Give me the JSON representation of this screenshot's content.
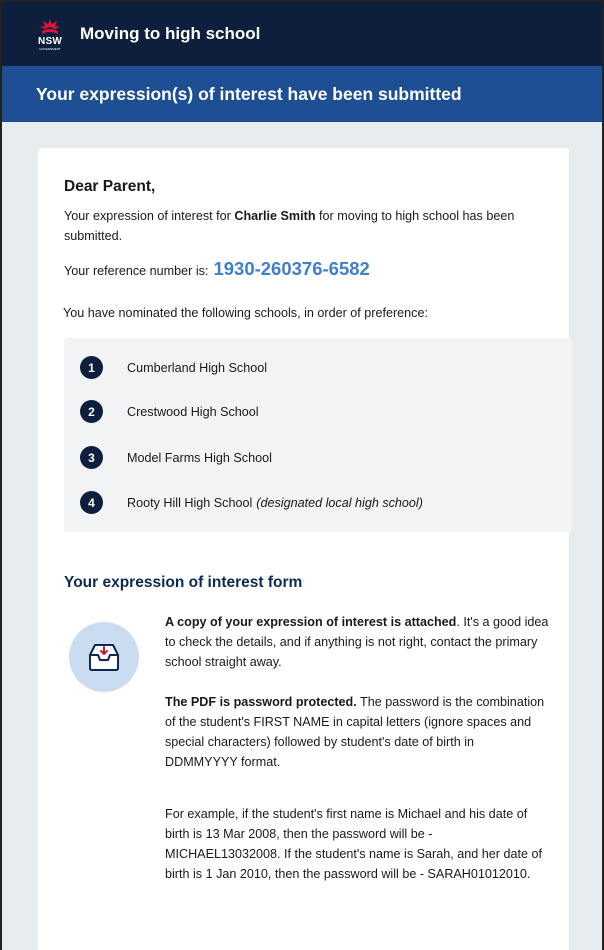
{
  "header": {
    "logo_text": "NSW",
    "logo_subtext": "GOVERNMENT",
    "app_title": "Moving to high school"
  },
  "banner": {
    "title": "Your expression(s) of interest have been submitted"
  },
  "letter": {
    "greeting": "Dear Parent,",
    "intro_prefix": "Your expression of interest for ",
    "student_name": "Charlie Smith",
    "intro_suffix": " for moving to high school has been submitted.",
    "reference_label": "Your reference number is:",
    "reference_number": "1930-260376-6582",
    "nominated_text": "You have nominated the following schools, in order of preference:"
  },
  "schools": [
    {
      "number": "1",
      "name": "Cumberland High School",
      "note": ""
    },
    {
      "number": "2",
      "name": "Crestwood High School",
      "note": ""
    },
    {
      "number": "3",
      "name": "Model Farms High School",
      "note": ""
    },
    {
      "number": "4",
      "name": "Rooty Hill High School",
      "note": "(designated local high school)"
    }
  ],
  "form_section": {
    "title": "Your expression of interest form",
    "icon": "inbox-download-icon",
    "attached_bold": "A copy of your expression of interest is attached",
    "attached_rest": ". It's a good idea to check the details, and if anything is not right, contact the primary school straight away.",
    "password_bold": "The PDF is password protected.",
    "password_rest": " The password is the combination of the student's FIRST NAME in capital letters (ignore spaces and special characters) followed by student's date of birth in DDMMYYYY format.",
    "example": "For example, if the student's first name is Michael and his date of birth is 13 Mar 2008, then the password will be - MICHAEL13032008. If the student's name is Sarah, and her date of birth is 1 Jan 2010, then the password will be - SARAH01012010."
  },
  "colors": {
    "header_bg": "#0d1f3c",
    "banner_bg": "#1e4f94",
    "reference": "#3f7fce",
    "page_bg": "#e9ecef",
    "accent_red": "#d7153a"
  }
}
